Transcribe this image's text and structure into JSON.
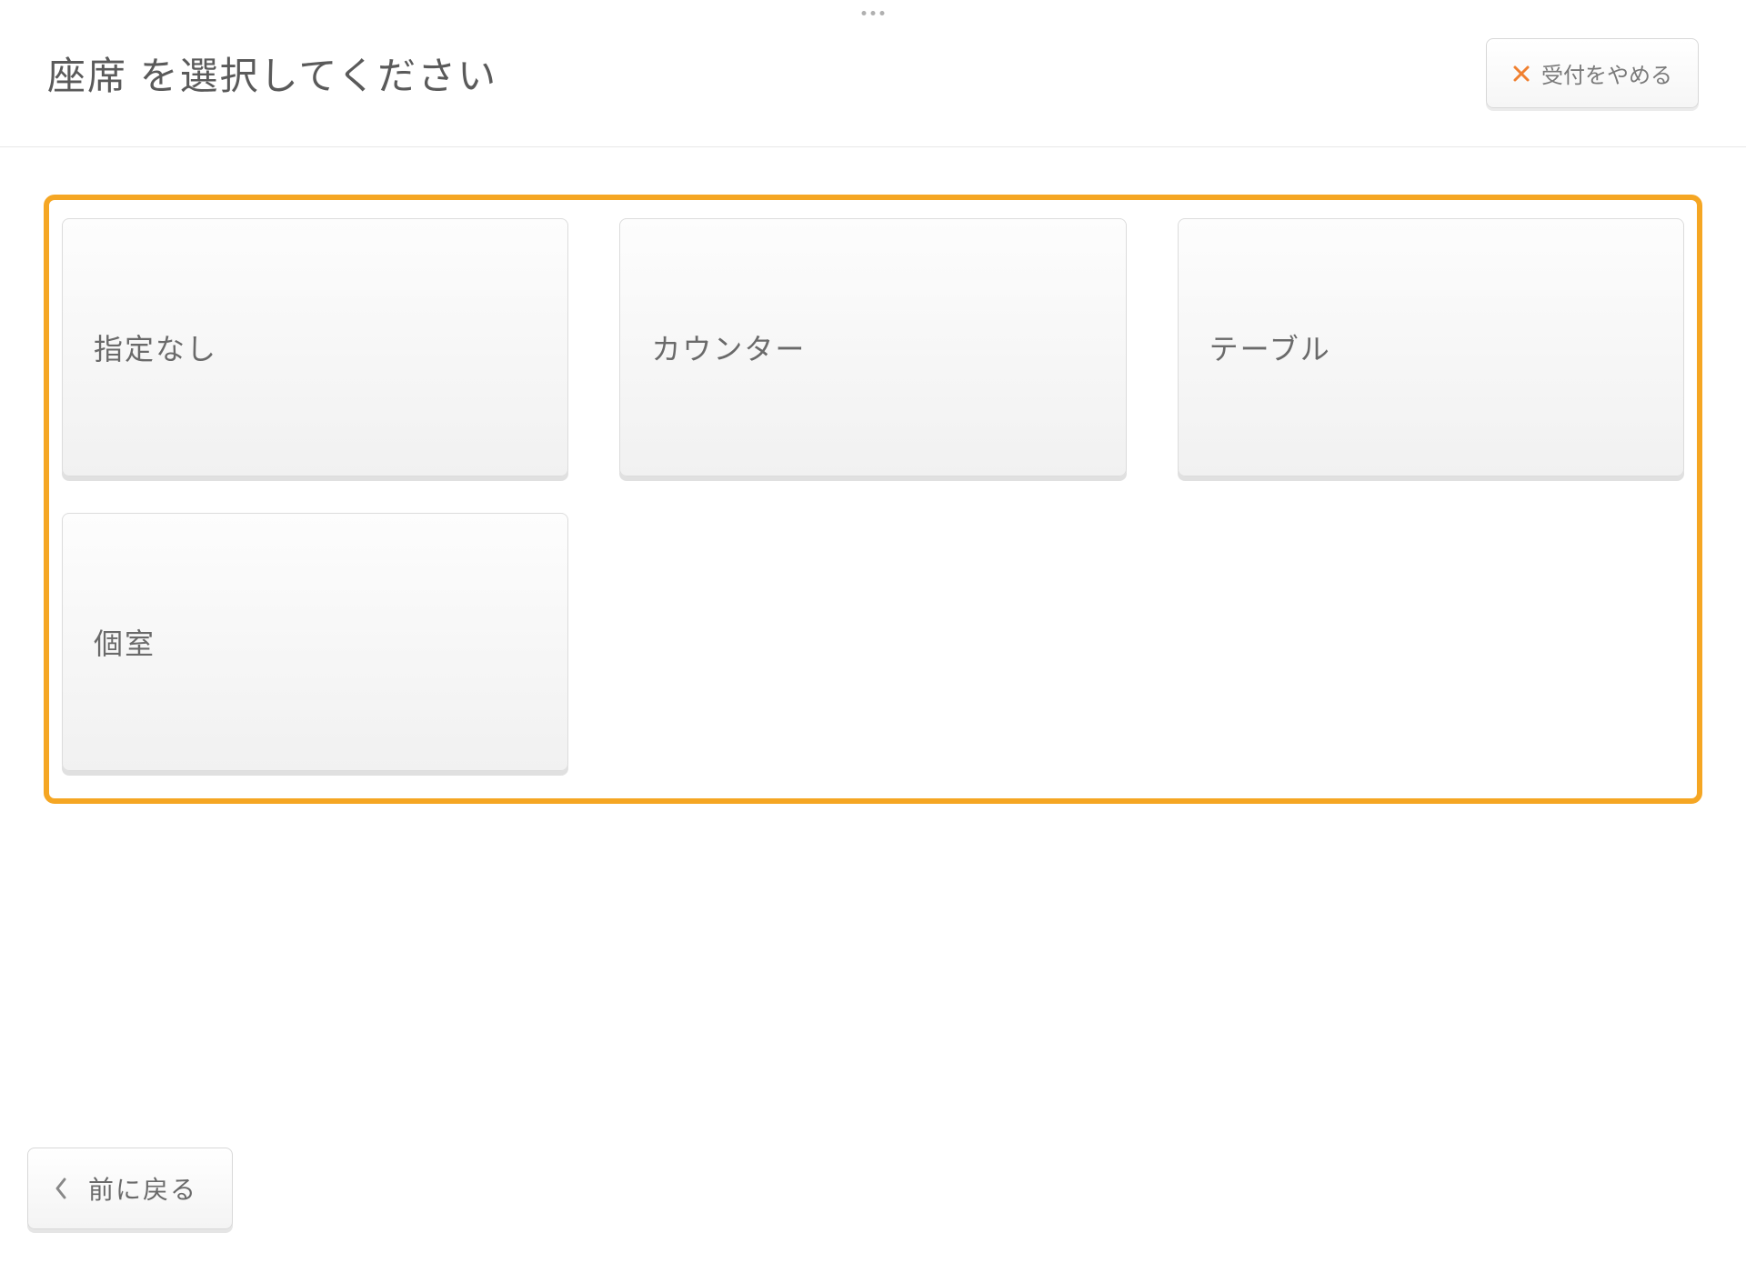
{
  "header": {
    "title": "座席 を選択してください",
    "cancel_label": "受付をやめる"
  },
  "options": [
    {
      "label": "指定なし"
    },
    {
      "label": "カウンター"
    },
    {
      "label": "テーブル"
    },
    {
      "label": "個室"
    }
  ],
  "footer": {
    "back_label": "前に戻る"
  },
  "colors": {
    "accent": "#f5a623",
    "close_icon": "#f08030"
  }
}
